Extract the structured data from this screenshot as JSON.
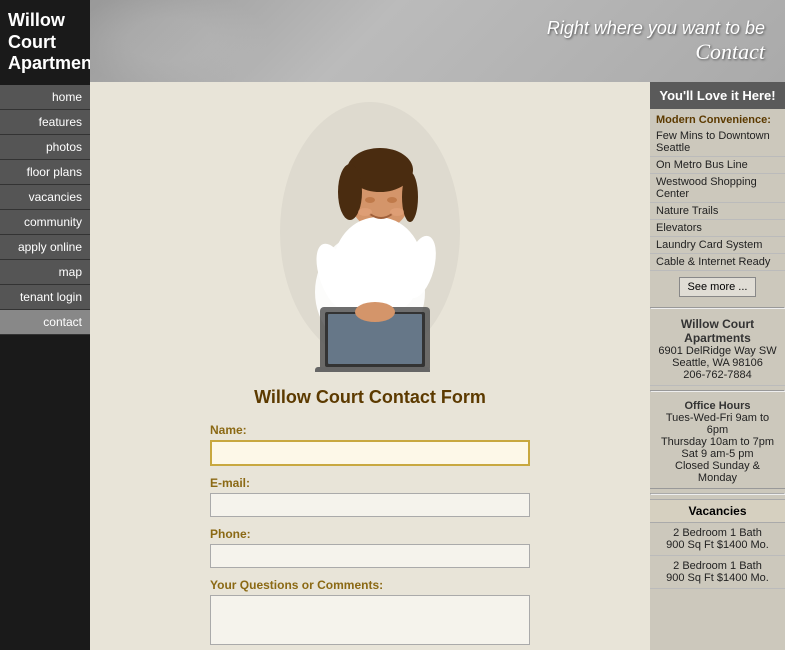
{
  "logo": {
    "text": "Willow Court Apartments"
  },
  "nav": {
    "items": [
      {
        "label": "home",
        "active": false
      },
      {
        "label": "features",
        "active": false
      },
      {
        "label": "photos",
        "active": false
      },
      {
        "label": "floor plans",
        "active": false
      },
      {
        "label": "vacancies",
        "active": false
      },
      {
        "label": "community",
        "active": false
      },
      {
        "label": "apply online",
        "active": false
      },
      {
        "label": "map",
        "active": false
      },
      {
        "label": "tenant login",
        "active": false
      },
      {
        "label": "contact",
        "active": true
      }
    ]
  },
  "header": {
    "tagline": "Right where you want to be",
    "title": "Contact"
  },
  "form": {
    "title": "Willow Court Contact Form",
    "name_label": "Name:",
    "email_label": "E-mail:",
    "phone_label": "Phone:",
    "comments_label": "Your Questions or Comments:"
  },
  "right_sidebar": {
    "love_header": "You'll Love it Here!",
    "modern_label": "Modern Convenience:",
    "amenities": [
      "Few Mins to Downtown Seattle",
      "On Metro Bus Line",
      "Westwood Shopping Center",
      "Nature Trails",
      "Elevators",
      "Laundry Card System",
      "Cable & Internet Ready"
    ],
    "see_more_btn": "See more ...",
    "address": {
      "name": "Willow Court Apartments",
      "street": "6901 DelRidge Way SW",
      "city": "Seattle, WA 98106",
      "phone": "206-762-7884"
    },
    "office_hours": {
      "label": "Office Hours",
      "hours": "Tues-Wed-Fri 9am to 6pm\nThursday 10am to 7pm\nSat 9 am-5 pm\nClosed Sunday & Monday"
    },
    "vacancies_header": "Vacancies",
    "vacancies": [
      {
        "desc": "2 Bedroom 1 Bath",
        "size": "900 Sq Ft  $1400 Mo."
      },
      {
        "desc": "2 Bedroom 1 Bath",
        "size": "900 Sq Ft  $1400 Mo."
      }
    ]
  }
}
